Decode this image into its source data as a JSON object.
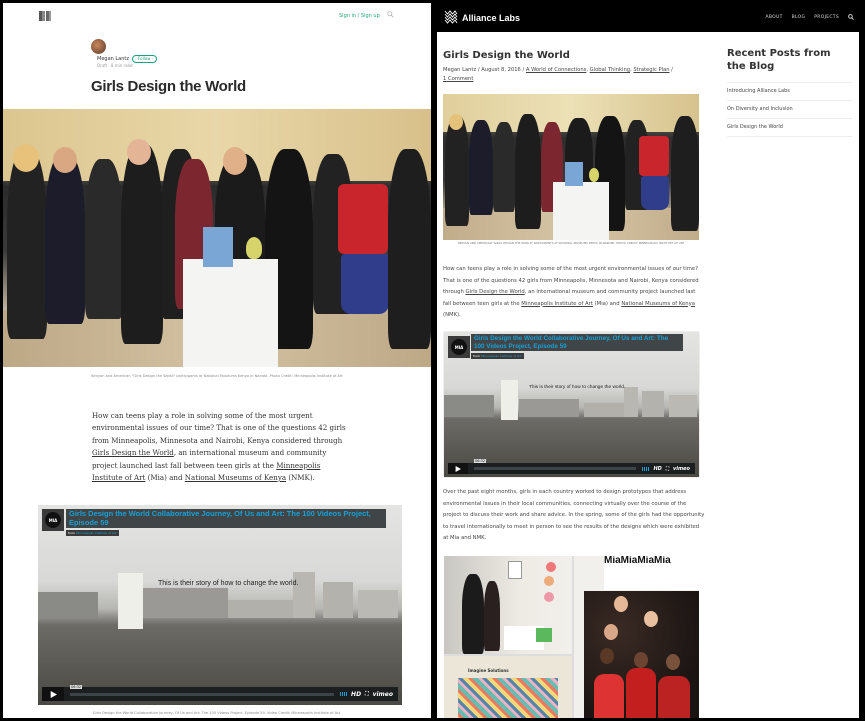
{
  "left": {
    "site": "Medium",
    "header": {
      "logo_icon": "medium-logo-icon",
      "signin_label": "Sign in / Sign up",
      "search_icon": "search-icon",
      "accent_color": "#1aa37a"
    },
    "author": {
      "name": "Megan Lantz",
      "follow_label": "Follow",
      "meta": "Draft · 8 min read"
    },
    "title": "Girls Design the World",
    "hero_caption": "Kenyan and American \"Girls Design the World\" participants at National Museums Kenya in Nairobi. Photo Credit: Minneapolis Institute of Art",
    "body": {
      "p1_before": "How can teens play a role in solving some of the most urgent environmental issues of our time? That is one of the questions 42 girls from Minneapolis, Minnesota and Nairobi, Kenya considered through ",
      "link1": "Girls Design the World",
      "p1_mid1": ", an international museum and community project launched last fall between teen girls at the ",
      "link2": "Minneapolis Institute of Art",
      "p1_mid2": " (Mia) and ",
      "link3": "National Museums of Kenya",
      "p1_end": " (NMK)."
    },
    "video_caption": "Girls Design the World Collaborative Journey, Of Us and Art: The 100 Videos Project, Episode 59. Video Credit: Minneapolis Institute of Art."
  },
  "video": {
    "badge": "MIA",
    "title": "Girls Design the World Collaborative Journey, Of Us and Art: The 100 Videos Project, Episode 59",
    "from_prefix": "from",
    "from_channel": "Minneapolis Institute of Art",
    "overlay_text": "This is their story of how to change the world.",
    "time": "06:32",
    "hd_label": "HD",
    "fullscreen_icon": "fullscreen-icon",
    "brand": "vimeo",
    "play_icon": "play-icon",
    "accent_color": "#19a0d6"
  },
  "right": {
    "site": "Alliance Labs",
    "header": {
      "logo_text": "Alliance Labs",
      "nav": [
        "ABOUT",
        "BLOG",
        "PROJECTS"
      ],
      "search_icon": "search-icon"
    },
    "title": "Girls Design the World",
    "meta": {
      "author": "Megan Lantz",
      "sep": " / ",
      "date": "August 8, 2016",
      "categories": [
        "A World of Connections",
        "Global Thinking",
        "Strategic Plan"
      ],
      "comments": "1 Comment"
    },
    "photo_caption": "KENYAN AND AMERICAN \"GIRLS DESIGN THE WORLD\" PARTICIPANTS AT NATIONAL MUSEUMS KENYA IN NAIROBI. PHOTO CREDIT: MINNEAPOLIS INSTITUTE OF ART",
    "body": {
      "p1_before": "How can teens play a role in solving some of the most urgent environmental issues of our time? That is one of the questions 42 girls from Minneapolis, Minnesota and Nairobi, Kenya considered through ",
      "link1": "Girls Design the World",
      "p1_mid1": ", an international museum and community project launched last fall between teen girls at the ",
      "link2": "Minneapolis Institute of Art",
      "p1_mid2": " (Mia) and ",
      "link3": "National Museums of Kenya",
      "p1_end": " (NMK).",
      "p2": "Over the past eight months, girls in each country worked to design prototypes that address environmental issues in their local communities, connecting virtually over the course of the project to discuss their work and share advice. In the spring, some of the girls had the opportunity to travel internationally to meet in person to see the results of the designs which were exhibited at Mia and NMK."
    },
    "collage": {
      "wall_text": "MiaMiaMiaMia",
      "board_text": "Imagine Solutions"
    },
    "sidebar": {
      "title": "Recent Posts from the Blog",
      "items": [
        "Introducing Alliance Labs",
        "On Diversity and Inclusion",
        "Girls Design the World"
      ]
    }
  }
}
